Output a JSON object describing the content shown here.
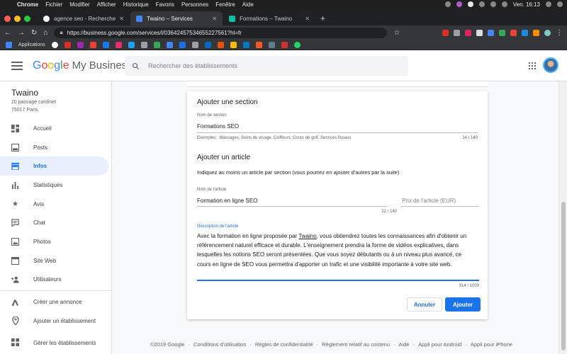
{
  "macos": {
    "menu": [
      "Chrome",
      "Fichier",
      "Modifier",
      "Afficher",
      "Historique",
      "Favoris",
      "Personnes",
      "Fenêtre",
      "Aide"
    ],
    "clock": "Ven. 16:13"
  },
  "browser": {
    "tabs": [
      {
        "label": "agence seo - Recherche Google",
        "color": "#4285f4",
        "active": false
      },
      {
        "label": "Twaino – Services",
        "color": "#4285f4",
        "active": true
      },
      {
        "label": "Formations – Twaino",
        "color": "#00bfa5",
        "active": false
      }
    ],
    "new_tab": "+",
    "url": "https://business.google.com/services/l/03642457534655227561?hl=fr",
    "bookmarks_label": "Applications"
  },
  "header": {
    "logo_google": "Google",
    "logo_product": "My Business",
    "search_placeholder": "Rechercher des établissements"
  },
  "sidebar": {
    "business_name": "Twaino",
    "address_line1": "20 passage cardinet",
    "address_line2": "75017 Paris",
    "items": [
      {
        "label": "Accueil",
        "icon": "dashboard-icon"
      },
      {
        "label": "Posts",
        "icon": "posts-icon"
      },
      {
        "label": "Infos",
        "icon": "store-icon",
        "active": true
      },
      {
        "label": "Statistiques",
        "icon": "bar-chart-icon"
      },
      {
        "label": "Avis",
        "icon": "star-icon"
      },
      {
        "label": "Chat",
        "icon": "chat-icon"
      },
      {
        "label": "Photos",
        "icon": "photo-icon"
      },
      {
        "label": "Site Web",
        "icon": "website-icon"
      },
      {
        "label": "Utilisateurs",
        "icon": "add-user-icon"
      }
    ],
    "secondary": [
      {
        "label": "Créer une annonce",
        "icon": "ads-icon"
      },
      {
        "label": "Ajouter un établissement",
        "icon": "location-pin-icon"
      }
    ],
    "bottom": {
      "label": "Gérer les établissements",
      "icon": "grid-icon"
    }
  },
  "form": {
    "section_title": "Ajouter une section",
    "section_name_label": "Nom de section",
    "section_name_value": "Formations SEO",
    "section_help": "Exemples : Massages, Soins du visage, Coiffeurs, Cours de golf, Services fiscaux",
    "section_count": "14 / 140",
    "article_title": "Ajouter un article",
    "article_hint": "Indiquez au moins un article par section (vous pourrez en ajouter d'autres par la suite)",
    "article_name_label": "Nom de l'article",
    "article_name_value": "Formation en ligne SEO",
    "article_price_placeholder": "Prix de l'article (EUR)",
    "article_name_count": "22 / 140",
    "description_label": "Description de l'article",
    "description_before": "Avec la formation en ligne proposée par ",
    "description_link": "Twaino",
    "description_after": ", vous obtiendrez toutes les connaissances afin d'obtenir un référencement naturel efficace et durable. L'enseignement prendra la forme de vidéos explicatives, dans lesquelles les notions SEO seront présentées. Que vous soyez débutants ou à un niveau plus avancé, ce cours en ligne de SEO vous permettra d'apporter un trafic et une visibilité importante à votre site web.",
    "description_count": "314 / 1000",
    "cancel_label": "Annuler",
    "add_label": "Ajouter"
  },
  "footer": {
    "links": [
      "©2019 Google",
      "Conditions d'utilisation",
      "Règles de confidentialité",
      "Règlement relatif au contenu",
      "Aide",
      "Appli pour Android",
      "Appli pour iPhone"
    ]
  },
  "colors": {
    "accent": "#1a73e8",
    "active_bg": "#e8f0fe"
  }
}
